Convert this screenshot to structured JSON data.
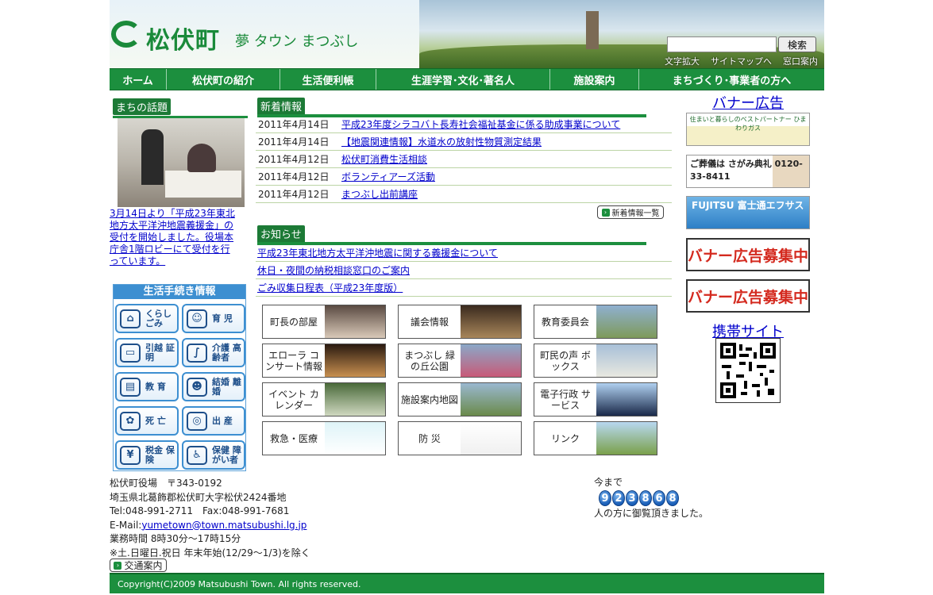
{
  "header": {
    "logo_text": "松伏町",
    "tagline": "夢 タウン まつぶし",
    "search_button": "検索",
    "search_value": "",
    "util_links": [
      "文字拡大",
      "サイトマップへ",
      "窓口案内"
    ]
  },
  "nav": [
    "ホーム",
    "松伏町の紹介",
    "生活便利帳",
    "生涯学習･文化･著名人",
    "施設案内",
    "まちづくり･事業者の方へ"
  ],
  "topic": {
    "heading": "まちの話題",
    "text": "3月14日より「平成23年東北地方太平洋沖地震義援金」の受付を開始しました。役場本庁舎1階ロビーにて受付を行っています。"
  },
  "procedures": {
    "title": "生活手続き情報",
    "items": [
      {
        "label": "くらし ごみ",
        "icon": "house-icon"
      },
      {
        "label": "育 児",
        "icon": "baby-face-icon"
      },
      {
        "label": "引越 証明",
        "icon": "truck-icon"
      },
      {
        "label": "介護 高齢者",
        "icon": "cane-icon"
      },
      {
        "label": "教 育",
        "icon": "school-icon"
      },
      {
        "label": "結婚 離婚",
        "icon": "couple-icon"
      },
      {
        "label": "死 亡",
        "icon": "flower-icon"
      },
      {
        "label": "出 産",
        "icon": "newborn-icon"
      },
      {
        "label": "税金 保険",
        "icon": "wallet-icon"
      },
      {
        "label": "保健 障がい者",
        "icon": "wheelchair-icon"
      }
    ]
  },
  "news": {
    "heading": "新着情報",
    "items": [
      {
        "date": "2011年4月14日",
        "title": "平成23年度シラコバト長寿社会福祉基金に係る助成事業について"
      },
      {
        "date": "2011年4月14日",
        "title": "【地震関連情報】水道水の放射性物質測定結果"
      },
      {
        "date": "2011年4月12日",
        "title": "松伏町消費生活相談"
      },
      {
        "date": "2011年4月12日",
        "title": "ボランティアーズ活動"
      },
      {
        "date": "2011年4月12日",
        "title": "まつぶし出前講座"
      }
    ],
    "more_label": "新着情報一覧"
  },
  "notices": {
    "heading": "お知らせ",
    "items": [
      "平成23年東北地方太平洋沖地震に関する義援金について",
      "休日・夜間の納税相談窓口のご案内",
      "ごみ収集日程表（平成23年度版）"
    ]
  },
  "tiles": [
    {
      "label": "町長の部屋",
      "colors": [
        "#5a4a42",
        "#d9c9b8"
      ]
    },
    {
      "label": "議会情報",
      "colors": [
        "#3a2a1e",
        "#a8865a"
      ]
    },
    {
      "label": "教育委員会",
      "colors": [
        "#8fb0d0",
        "#7e9a5a"
      ]
    },
    {
      "label": "エローラ コンサート情報",
      "colors": [
        "#2a1a10",
        "#c89050"
      ]
    },
    {
      "label": "まつぶし 緑の丘公園",
      "colors": [
        "#8aa8c8",
        "#c85a78"
      ]
    },
    {
      "label": "町民の声 ボックス",
      "colors": [
        "#a8c0d8",
        "#e8e8e0"
      ]
    },
    {
      "label": "イベント カレンダー",
      "colors": [
        "#4a6a3a",
        "#cfd8c0"
      ]
    },
    {
      "label": "施設案内地図",
      "colors": [
        "#9ab8d0",
        "#6a8a4a"
      ]
    },
    {
      "label": "電子行政 サービス",
      "colors": [
        "#b0d0f0",
        "#1a2a4a"
      ]
    },
    {
      "label": "救急・医療",
      "colors": [
        "#dff4f8",
        "#ffffff"
      ]
    },
    {
      "label": "防 災",
      "colors": [
        "#ffffff",
        "#f0f0f0"
      ]
    },
    {
      "label": "リンク",
      "colors": [
        "#b8d8f0",
        "#7aa04a"
      ]
    }
  ],
  "right": {
    "banner_heading": "バナー広告",
    "banners": [
      "住まいと暮らしのベストパートナー ひまわりガス",
      "ご葬儀は さがみ典礼 0120-33-8411",
      "FUJITSU 富士通エフサス",
      "バナー広告募集中",
      "バナー広告募集中"
    ],
    "mobile_heading": "携帯サイト"
  },
  "footer": {
    "lines": [
      "松伏町役場　〒343-0192",
      "埼玉県北葛飾郡松伏町大字松伏2424番地",
      "Tel:048-991-2711　Fax:048-991-7681",
      "E-Mail:",
      "業務時間 8時30分～17時15分",
      "※土.日曜日.祝日 年末年始(12/29～1/3)を除く"
    ],
    "email": "yumetown@town.matsubushi.lg.jp",
    "access_label": "交通案内",
    "counter_prefix": "今まで",
    "counter_digits": [
      "9",
      "2",
      "3",
      "8",
      "6",
      "8"
    ],
    "counter_suffix": "人の方に御覧頂きました。",
    "copyright": "Copyright(C)2009 Matsubushi Town. All rights reserved."
  },
  "colors": {
    "brand_green": "#1c8f3e",
    "link_blue": "#0000cc",
    "proc_blue": "#3d8fd1",
    "ad_red": "#d42a1f"
  }
}
